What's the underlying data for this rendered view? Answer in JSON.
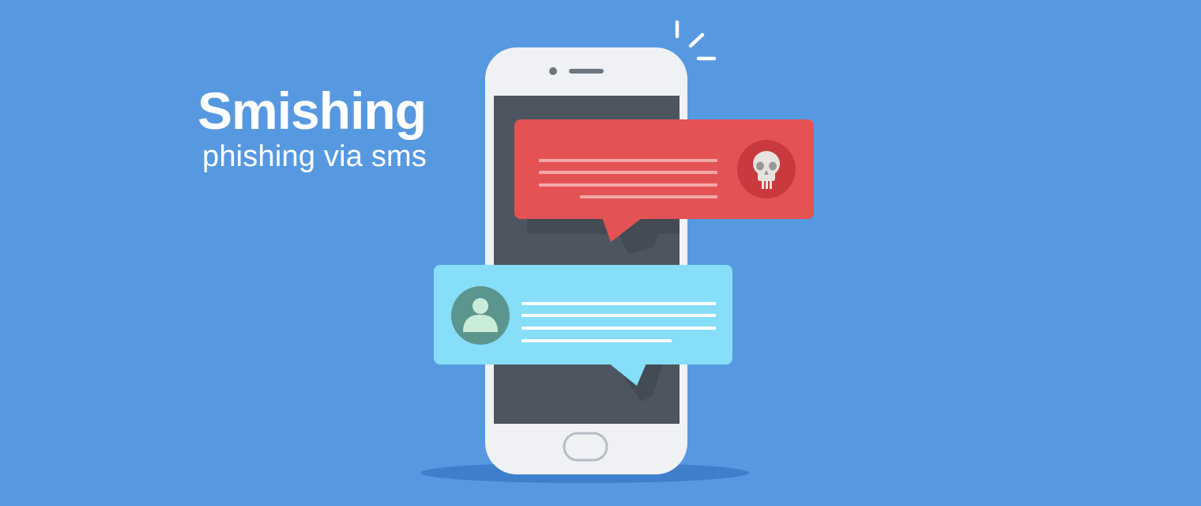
{
  "headline": {
    "title": "Smishing",
    "subtitle": "phishing via sms"
  },
  "colors": {
    "background": "#5799e0",
    "phone_body": "#eff1f4",
    "phone_screen": "#4d5660",
    "malicious_bubble": "#e45254",
    "malicious_lines": "#f1a8a8",
    "skull_badge": "#c83a3e",
    "skull": "#e7e4e0",
    "legit_bubble": "#86def9",
    "legit_lines": "#ffffff",
    "avatar_badge": "#5b958d",
    "avatar": "#c9ecd8",
    "shadow": "#3f7ecb",
    "alert_marks": "#ffffff"
  },
  "icons": {
    "malicious_sender": "skull-icon",
    "legit_sender": "user-icon",
    "alert": "alert-burst-icon"
  }
}
